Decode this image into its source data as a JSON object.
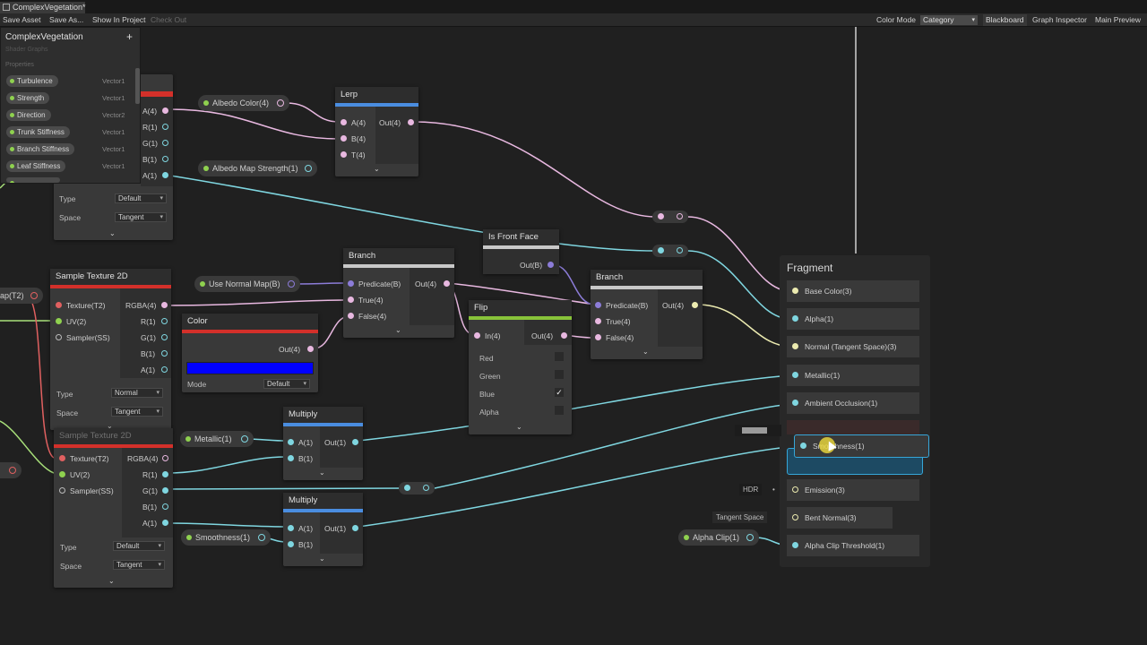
{
  "window": {
    "tab_title": "ComplexVegetation*"
  },
  "toolbar": {
    "save_asset": "Save Asset",
    "save_as": "Save As...",
    "show_in_project": "Show In Project",
    "check_out": "Check Out",
    "color_mode_label": "Color Mode",
    "color_mode_value": "Category",
    "blackboard": "Blackboard",
    "graph_inspector": "Graph Inspector",
    "main_preview": "Main Preview"
  },
  "blackboard": {
    "title": "ComplexVegetation",
    "subtitle": "Shader Graphs",
    "section": "Properties",
    "add_symbol": "+",
    "properties": [
      {
        "name": "Turbulence",
        "type": "Vector1"
      },
      {
        "name": "Strength",
        "type": "Vector1"
      },
      {
        "name": "Direction",
        "type": "Vector2"
      },
      {
        "name": "Trunk Stiffness",
        "type": "Vector1"
      },
      {
        "name": "Branch Stiffness",
        "type": "Vector1"
      },
      {
        "name": "Leaf Stiffness",
        "type": "Vector1"
      }
    ]
  },
  "top_sampler": {
    "outputs": [
      "A(4)",
      "R(1)",
      "G(1)",
      "B(1)",
      "A(1)"
    ],
    "type_label": "Type",
    "type_value": "Default",
    "space_label": "Space",
    "space_value": "Tangent"
  },
  "properties_nodes": {
    "albedo_color": "Albedo Color(4)",
    "albedo_map_strength": "Albedo Map Strength(1)",
    "use_normal_map": "Use Normal Map(B)",
    "metallic": "Metallic(1)",
    "smoothness": "Smoothness(1)",
    "normal_map_stub": "ap(T2)",
    "alpha_clip": "Alpha Clip(1)",
    "tangent_space": "Tangent Space",
    "hdr": "HDR"
  },
  "lerp": {
    "title": "Lerp",
    "in_a": "A(4)",
    "in_b": "B(4)",
    "in_t": "T(4)",
    "out": "Out(4)"
  },
  "sample_texture": {
    "title": "Sample Texture 2D",
    "in_tex": "Texture(T2)",
    "in_uv": "UV(2)",
    "in_sampler": "Sampler(SS)",
    "outputs": [
      "RGBA(4)",
      "R(1)",
      "G(1)",
      "B(1)",
      "A(1)"
    ],
    "type_label": "Type",
    "type_value": "Normal",
    "space_label": "Space",
    "space_value": "Tangent"
  },
  "sample_texture_2": {
    "title": "Sample Texture 2D",
    "in_tex": "Texture(T2)",
    "in_uv": "UV(2)",
    "in_sampler": "Sampler(SS)",
    "outputs": [
      "RGBA(4)",
      "R(1)",
      "G(1)",
      "B(1)",
      "A(1)"
    ],
    "type_label": "Type",
    "type_value": "Default",
    "space_label": "Space",
    "space_value": "Tangent"
  },
  "branch1": {
    "title": "Branch",
    "in_pred": "Predicate(B)",
    "in_true": "True(4)",
    "in_false": "False(4)",
    "out": "Out(4)"
  },
  "branch2": {
    "title": "Branch",
    "in_pred": "Predicate(B)",
    "in_true": "True(4)",
    "in_false": "False(4)",
    "out": "Out(4)"
  },
  "color_node": {
    "title": "Color",
    "out": "Out(4)",
    "mode_label": "Mode",
    "mode_value": "Default",
    "swatch": "#0000ff"
  },
  "is_front_face": {
    "title": "Is Front Face",
    "out": "Out(B)"
  },
  "flip": {
    "title": "Flip",
    "in": "In(4)",
    "out": "Out(4)",
    "channels": [
      {
        "label": "Red",
        "checked": false
      },
      {
        "label": "Green",
        "checked": false
      },
      {
        "label": "Blue",
        "checked": true
      },
      {
        "label": "Alpha",
        "checked": false
      }
    ],
    "check_glyph": "✓"
  },
  "multiply1": {
    "title": "Multiply",
    "in_a": "A(1)",
    "in_b": "B(1)",
    "out": "Out(1)"
  },
  "multiply2": {
    "title": "Multiply",
    "in_a": "A(1)",
    "in_b": "B(1)",
    "out": "Out(1)"
  },
  "fragment": {
    "title": "Fragment",
    "slots": [
      "Base Color(3)",
      "Alpha(1)",
      "Normal (Tangent Space)(3)",
      "Metallic(1)",
      "Ambient Occlusion(1)",
      "Smoothness(1)",
      "Emission(3)",
      "Bent Normal(3)",
      "Alpha Clip Threshold(1)"
    ]
  },
  "colors": {
    "accent_red": "#d3302a",
    "accent_blue": "#4a8de0",
    "accent_green": "#88c33a",
    "accent_gray": "#c8c8c8",
    "wire_pink": "#e8b8e0",
    "wire_cyan": "#7fd6e0",
    "wire_yellow": "#ecebb0",
    "wire_purple": "#8c7cd8",
    "wire_green": "#a8e07a",
    "selection": "#36a6d8"
  }
}
